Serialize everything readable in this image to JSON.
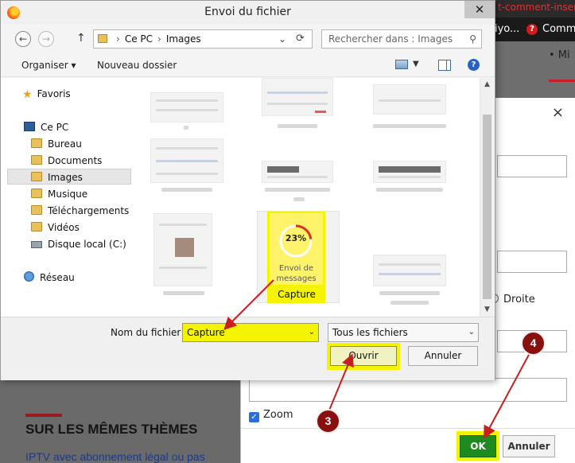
{
  "background": {
    "topbar_text": "t-comment-inser",
    "nav_a": "iyo...",
    "nav_b": "Comme",
    "bullet": "• Mi",
    "heading": "SUR LES MÊMES THÈMES",
    "link": "IPTV avec abonnement légal ou pas"
  },
  "dialog2": {
    "close": "×",
    "droite": "Droite",
    "zoom": "Zoom",
    "ok": "OK",
    "annuler": "Annuler"
  },
  "file_dialog": {
    "title": "Envoi du fichier",
    "close": "✕",
    "address": {
      "crumbs": [
        "Ce PC",
        "Images"
      ]
    },
    "search_placeholder": "Rechercher dans : Images",
    "toolbar": {
      "organise": "Organiser ▾",
      "new_folder": "Nouveau dossier"
    },
    "nav": {
      "favoris": "Favoris",
      "ce_pc": "Ce PC",
      "bureau": "Bureau",
      "documents": "Documents",
      "images": "Images",
      "musique": "Musique",
      "telechargements": "Téléchargements",
      "videos": "Vidéos",
      "disque": "Disque local (C:)",
      "reseau": "Réseau"
    },
    "capture_thumb": {
      "percent": "23%",
      "label": "Envoi de messages",
      "name": "Capture",
      "progress": 0.23
    },
    "footer": {
      "filename_label": "Nom du fichier :",
      "filename_value": "Capture",
      "filetype": "Tous les fichiers",
      "open": "Ouvrir",
      "cancel": "Annuler"
    }
  },
  "markers": {
    "m3": "3",
    "m4": "4"
  },
  "colors": {
    "highlight": "#f4f400",
    "marker": "#8a1010",
    "ok_green": "#1e8b1e",
    "arrow": "#c81e1e"
  }
}
